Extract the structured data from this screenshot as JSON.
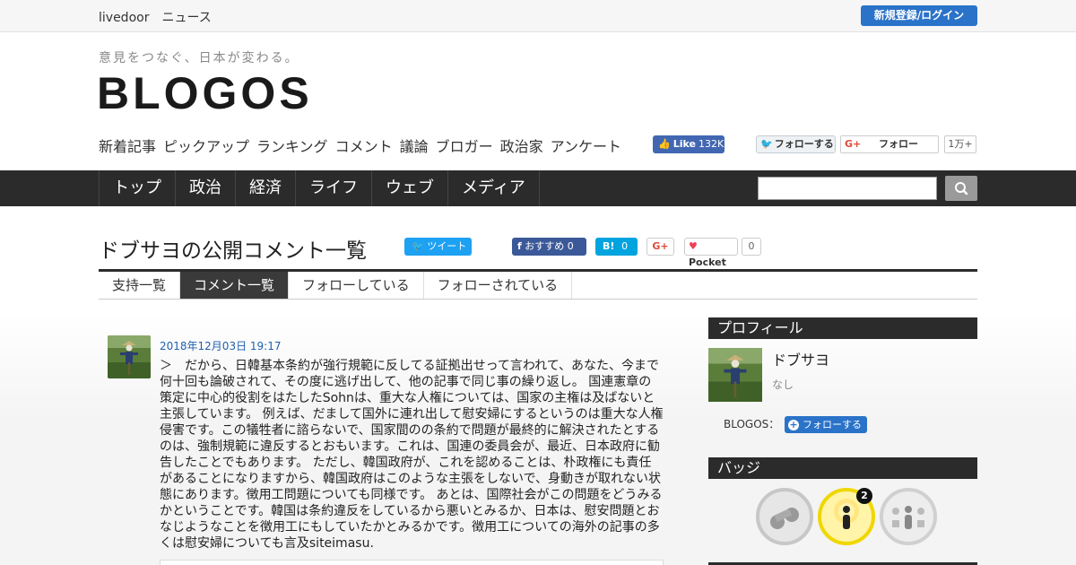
{
  "topbar": {
    "brand": "livedoor　ニュース",
    "login_label": "新規登録/ログイン"
  },
  "header": {
    "tagline": "意見をつなぐ、日本が変わる。",
    "logo": "BLOGOS",
    "nav": [
      "新着記事",
      "ピックアップ",
      "ランキング",
      "コメント",
      "議論",
      "ブロガー",
      "政治家",
      "アンケート"
    ],
    "fb_like": {
      "label": "Like",
      "count": "132K"
    },
    "twitter_follow": "フォローする",
    "gplus": {
      "label": "フォロー",
      "count": "1万+"
    }
  },
  "category_nav": [
    "トップ",
    "政治",
    "経済",
    "ライフ",
    "ウェブ",
    "メディア"
  ],
  "search": {
    "placeholder": ""
  },
  "page": {
    "title": "ドブサヨの公開コメント一覧",
    "share": {
      "tweet": "ツイート",
      "fb_recommend": "おすすめ",
      "fb_count": "0",
      "hatena_label": "B!",
      "hatena_count": "0",
      "gplus": "G+",
      "pocket": "Pocket",
      "pocket_count": "0"
    },
    "tabs": [
      {
        "label": "支持一覧",
        "active": false
      },
      {
        "label": "コメント一覧",
        "active": true
      },
      {
        "label": "フォローしている",
        "active": false
      },
      {
        "label": "フォローされている",
        "active": false
      }
    ]
  },
  "comment": {
    "date": "2018年12月03日 19:17",
    "text": "＞　だから、日韓基本条約が強行規範に反してる証拠出せって言われて、あなた、今まで何十回も論破されて、その度に逃げ出して、他の記事で同じ事の繰り返し。 国連憲章の策定に中心的役割をはたしたSohnは、重大な人権については、国家の主権は及ばないと主張しています。 例えば、だまして国外に連れ出して慰安婦にするというのは重大な人権侵害です。この犠牲者に諮らないで、国家間のの条約で問題が最終的に解決されたとするのは、強制規範に違反するとおもいます。これは、国連の委員会が、最近、日本政府に勧告したことでもあります。 ただし、韓国政府が、これを認めることは、朴政権にも責任があることになりますから、韓国政府はこのような主張をしないで、身動きが取れない状態にあります。徴用工問題についても同様です。 あとは、国際社会がこの問題をどうみるかということです。韓国は条約違反をしているから悪いとみるか、日本は、慰安問題とおなじようなことを徴用工にもしていたかとみるかです。徴用工についての海外の記事の多くは慰安婦についても言及siteimasu."
  },
  "sidebar": {
    "profile_heading": "プロフィール",
    "name": "ドブサヨ",
    "subtitle": "なし",
    "follow_label": "BLOGOS：",
    "follow_button": "フォローする",
    "badge_heading": "バッジ",
    "badge_count": "2"
  },
  "colors": {
    "accent_blue": "#2a73c9",
    "nav_dark": "#2b2b2b",
    "badge_gold": "#f0d700"
  }
}
